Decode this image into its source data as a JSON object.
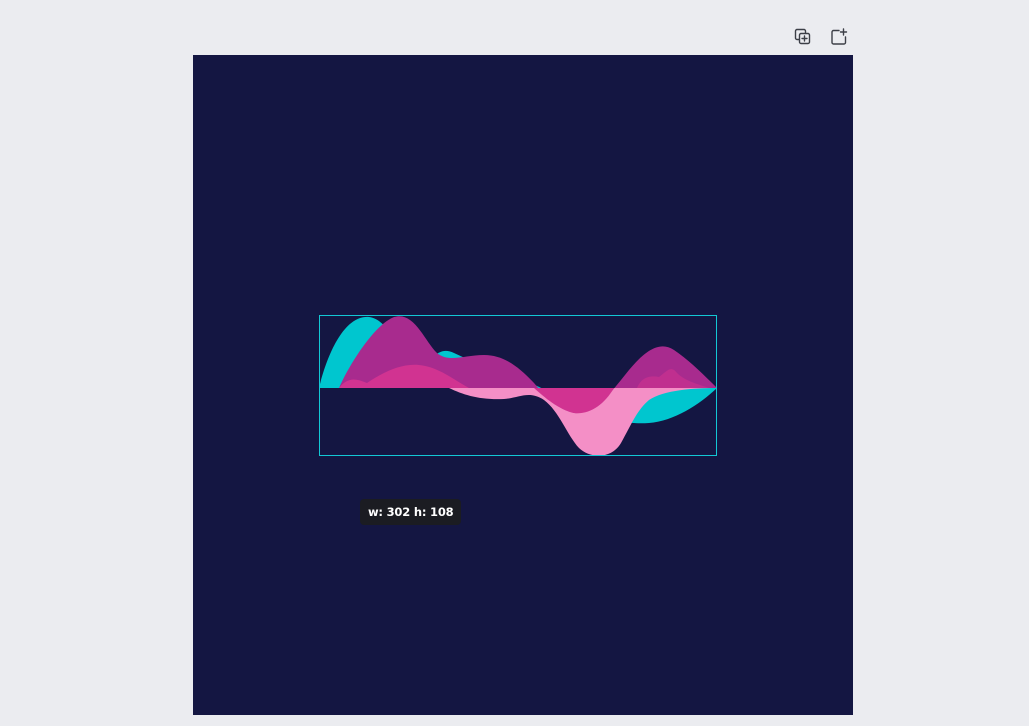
{
  "toolbar": {
    "duplicate_icon": "duplicate-page-icon",
    "add_page_icon": "add-page-icon"
  },
  "canvas": {
    "background_color": "#141642"
  },
  "selection": {
    "border_color": "#13c7d4",
    "tooltip_text": "w: 302 h: 108"
  },
  "graphic": {
    "name": "wave-graphic",
    "colors": {
      "cyan": "#00c6cf",
      "magenta": "#a82b8e",
      "pink": "#f48fc6",
      "hot_pink": "#d13391"
    }
  }
}
